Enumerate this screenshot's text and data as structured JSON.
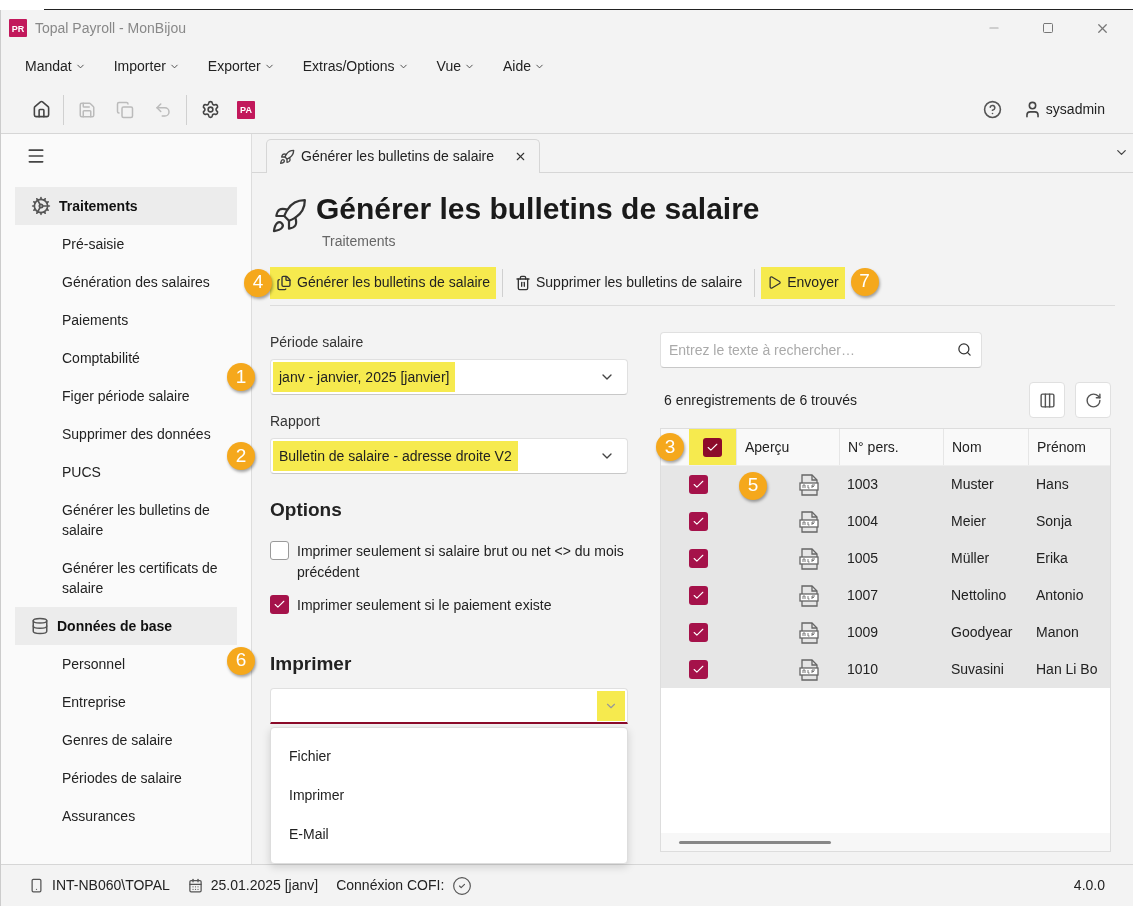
{
  "window": {
    "logo": "PR",
    "title": "Topal Payroll - MonBijou"
  },
  "menu": [
    {
      "label": "Mandat"
    },
    {
      "label": "Importer"
    },
    {
      "label": "Exporter"
    },
    {
      "label": "Extras/Options"
    },
    {
      "label": "Vue"
    },
    {
      "label": "Aide"
    }
  ],
  "toolbar": {
    "logo": "PA",
    "user": "sysadmin"
  },
  "sidebar": {
    "sections": [
      {
        "kind": "gears",
        "title": "Traitements",
        "items": [
          "Pré-saisie",
          "Génération des salaires",
          "Paiements",
          "Comptabilité",
          "Figer période salaire",
          "Supprimer des données",
          "PUCS",
          "Générer les bulletins de salaire",
          "Générer les certificats de salaire"
        ]
      },
      {
        "kind": "database",
        "title": "Données de base",
        "items": [
          "Personnel",
          "Entreprise",
          "Genres de salaire",
          "Périodes de salaire",
          "Assurances"
        ]
      }
    ]
  },
  "tab": {
    "label": "Générer les bulletins de salaire"
  },
  "page": {
    "title": "Générer les bulletins de salaire",
    "subtitle": "Traitements"
  },
  "actions": [
    {
      "kind": "generate",
      "label": "Générer les bulletins de salaire",
      "highlighted": true,
      "callout": "4"
    },
    {
      "kind": "delete",
      "label": "Supprimer les bulletins de salaire",
      "highlighted": false
    },
    {
      "kind": "send",
      "label": "Envoyer",
      "highlighted": true,
      "callout": "7"
    }
  ],
  "period": {
    "label": "Période salaire",
    "value": "janv - janvier, 2025 [janvier]",
    "highlighted": true,
    "callout": "1"
  },
  "report": {
    "label": "Rapport",
    "value": "Bulletin de salaire - adresse droite V2",
    "highlighted": true,
    "callout": "2"
  },
  "options": {
    "title": "Options",
    "items": [
      {
        "label": "Imprimer seulement si salaire brut ou net <> du mois précédent",
        "checked": false
      },
      {
        "label": "Imprimer seulement si le paiement existe",
        "checked": true
      }
    ]
  },
  "print": {
    "title": "Imprimer",
    "callout": "6",
    "expanded": true,
    "caret_highlighted": true,
    "menu": [
      "Fichier",
      "Imprimer",
      "E-Mail"
    ]
  },
  "search": {
    "placeholder": "Entrez le texte à rechercher…"
  },
  "count": "6 enregistrements de 6 trouvés",
  "table": {
    "columns": [
      "Aperçu",
      "N° pers.",
      "Nom",
      "Prénom"
    ],
    "header_checked": true,
    "header_highlighted": true,
    "header_callout": "3",
    "preview_callout": "5",
    "rows": [
      {
        "checked": true,
        "number": "1003",
        "name": "Muster",
        "first_name": "Hans"
      },
      {
        "checked": true,
        "number": "1004",
        "name": "Meier",
        "first_name": "Sonja"
      },
      {
        "checked": true,
        "number": "1005",
        "name": "Müller",
        "first_name": "Erika"
      },
      {
        "checked": true,
        "number": "1007",
        "name": "Nettolino",
        "first_name": "Antonio"
      },
      {
        "checked": true,
        "number": "1009",
        "name": "Goodyear",
        "first_name": "Manon"
      },
      {
        "checked": true,
        "number": "1010",
        "name": "Suvasini",
        "first_name": "Han Li Bo"
      }
    ]
  },
  "status_bar": {
    "machine": "INT-NB060\\TOPAL",
    "date": "25.01.2025 [janv]",
    "cofi_label": "Connéxion COFI:",
    "cofi_ok": true,
    "version": "4.0.0"
  }
}
